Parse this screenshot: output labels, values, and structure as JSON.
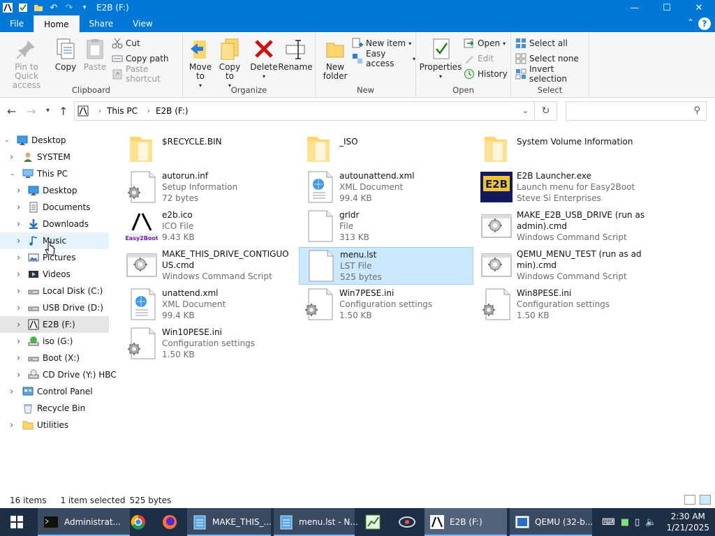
{
  "window": {
    "title": "E2B (F:)",
    "controls": {
      "minimize": "—",
      "maximize": "☐",
      "close": "✕"
    }
  },
  "tabs": [
    "File",
    "Home",
    "Share",
    "View"
  ],
  "ribbon": {
    "clipboard": {
      "label": "Clipboard",
      "pin": "Pin to Quick access",
      "copy": "Copy",
      "paste": "Paste",
      "cut": "Cut",
      "copy_path": "Copy path",
      "paste_shortcut": "Paste shortcut"
    },
    "organize": {
      "label": "Organize",
      "move_to": "Move to",
      "copy_to": "Copy to",
      "delete": "Delete",
      "rename": "Rename"
    },
    "new": {
      "label": "New",
      "new_folder": "New folder",
      "new_item": "New item",
      "easy_access": "Easy access"
    },
    "open": {
      "label": "Open",
      "properties": "Properties",
      "open": "Open",
      "edit": "Edit",
      "history": "History"
    },
    "select": {
      "label": "Select",
      "select_all": "Select all",
      "select_none": "Select none",
      "invert": "Invert selection"
    }
  },
  "address": {
    "crumbs": [
      "This PC",
      "E2B (F:)"
    ],
    "search_placeholder": ""
  },
  "nav": [
    {
      "label": "Desktop",
      "level": 0,
      "expanded": true,
      "icon": "desktop-icon"
    },
    {
      "label": "SYSTEM",
      "level": 1,
      "expanded": false,
      "icon": "user-icon"
    },
    {
      "label": "This PC",
      "level": 1,
      "expanded": true,
      "icon": "pc-icon"
    },
    {
      "label": "Desktop",
      "level": 2,
      "expanded": false,
      "icon": "desktop-icon"
    },
    {
      "label": "Documents",
      "level": 2,
      "expanded": false,
      "icon": "documents-icon"
    },
    {
      "label": "Downloads",
      "level": 2,
      "expanded": false,
      "icon": "downloads-icon"
    },
    {
      "label": "Music",
      "level": 2,
      "expanded": false,
      "icon": "music-icon",
      "state": "hover"
    },
    {
      "label": "Pictures",
      "level": 2,
      "expanded": false,
      "icon": "pictures-icon"
    },
    {
      "label": "Videos",
      "level": 2,
      "expanded": false,
      "icon": "videos-icon"
    },
    {
      "label": "Local Disk (C:)",
      "level": 2,
      "expanded": false,
      "icon": "drive-icon"
    },
    {
      "label": "USB Drive (D:)",
      "level": 2,
      "expanded": false,
      "icon": "drive-icon"
    },
    {
      "label": "E2B (F:)",
      "level": 2,
      "expanded": false,
      "icon": "e2b-drive-icon",
      "state": "selected"
    },
    {
      "label": "iso (G:)",
      "level": 2,
      "expanded": false,
      "icon": "iso-drive-icon"
    },
    {
      "label": "Boot (X:)",
      "level": 2,
      "expanded": false,
      "icon": "drive-icon"
    },
    {
      "label": "CD Drive (Y:) HBC",
      "level": 2,
      "expanded": false,
      "icon": "cd-drive-icon"
    },
    {
      "label": "Control Panel",
      "level": 1,
      "expanded": false,
      "icon": "control-panel-icon"
    },
    {
      "label": "Recycle Bin",
      "level": 1,
      "expanded": null,
      "icon": "recycle-bin-icon"
    },
    {
      "label": "Utilities",
      "level": 1,
      "expanded": false,
      "icon": "folder-icon"
    }
  ],
  "files": [
    {
      "name": "$RECYCLE.BIN",
      "type": "",
      "size": "",
      "icon": "folder-icon"
    },
    {
      "name": "_ISO",
      "type": "",
      "size": "",
      "icon": "folder-icon"
    },
    {
      "name": "System Volume Information",
      "type": "",
      "size": "",
      "icon": "folder-icon"
    },
    {
      "name": "autorun.inf",
      "type": "Setup Information",
      "size": "72 bytes",
      "icon": "settings-file-icon"
    },
    {
      "name": "autounattend.xml",
      "type": "XML Document",
      "size": "99.4 KB",
      "icon": "xml-file-icon"
    },
    {
      "name": "E2B Launcher.exe",
      "type": "Launch menu for Easy2Boot",
      "size": "Steve Si Enterprises",
      "icon": "e2b-launcher-icon"
    },
    {
      "name": "e2b.ico",
      "type": "ICO File",
      "size": "9.43 KB",
      "icon": "e2b-ico-icon"
    },
    {
      "name": "grldr",
      "type": "File",
      "size": "313 KB",
      "icon": "blank-file-icon"
    },
    {
      "name": "MAKE_E2B_USB_DRIVE (run as admin).cmd",
      "type": "Windows Command Script",
      "size": "",
      "icon": "cmd-file-icon"
    },
    {
      "name": "MAKE_THIS_DRIVE_CONTIGUOUS.cmd",
      "type": "Windows Command Script",
      "size": "",
      "icon": "cmd-file-icon"
    },
    {
      "name": "menu.lst",
      "type": "LST File",
      "size": "525 bytes",
      "icon": "blank-file-icon",
      "selected": true
    },
    {
      "name": "QEMU_MENU_TEST (run as admin).cmd",
      "type": "Windows Command Script",
      "size": "",
      "icon": "cmd-file-icon"
    },
    {
      "name": "unattend.xml",
      "type": "XML Document",
      "size": "99.4 KB",
      "icon": "xml-file-icon"
    },
    {
      "name": "Win7PESE.ini",
      "type": "Configuration settings",
      "size": "1.50 KB",
      "icon": "settings-file-icon"
    },
    {
      "name": "Win8PESE.ini",
      "type": "Configuration settings",
      "size": "1.50 KB",
      "icon": "settings-file-icon"
    },
    {
      "name": "Win10PESE.ini",
      "type": "Configuration settings",
      "size": "1.50 KB",
      "icon": "settings-file-icon"
    }
  ],
  "status": {
    "count": "16 items",
    "selection": "1 item selected",
    "size": "525 bytes"
  },
  "taskbar": {
    "items": [
      {
        "label": "Administrat...",
        "icon": "cmd-icon",
        "state": "running"
      },
      {
        "label": "",
        "icon": "chrome-icon",
        "state": "pinned"
      },
      {
        "label": "",
        "icon": "firefox-icon",
        "state": "pinned"
      },
      {
        "label": "MAKE_THIS_...",
        "icon": "notepad-icon",
        "state": "running"
      },
      {
        "label": "menu.lst - N...",
        "icon": "notepad-icon",
        "state": "running"
      },
      {
        "label": "",
        "icon": "chart-app-icon",
        "state": "pinned"
      },
      {
        "label": "",
        "icon": "network-app-icon",
        "state": "pinned"
      },
      {
        "label": "E2B (F:)",
        "icon": "e2b-icon",
        "state": "active"
      },
      {
        "label": "QEMU (32-b...",
        "icon": "qemu-icon",
        "state": "running"
      }
    ],
    "clock": {
      "time": "2:30 AM",
      "date": "1/21/2025"
    }
  },
  "colors": {
    "accent": "#0078d7",
    "selection": "#cce8ff",
    "taskbar": "#1d2e45"
  }
}
